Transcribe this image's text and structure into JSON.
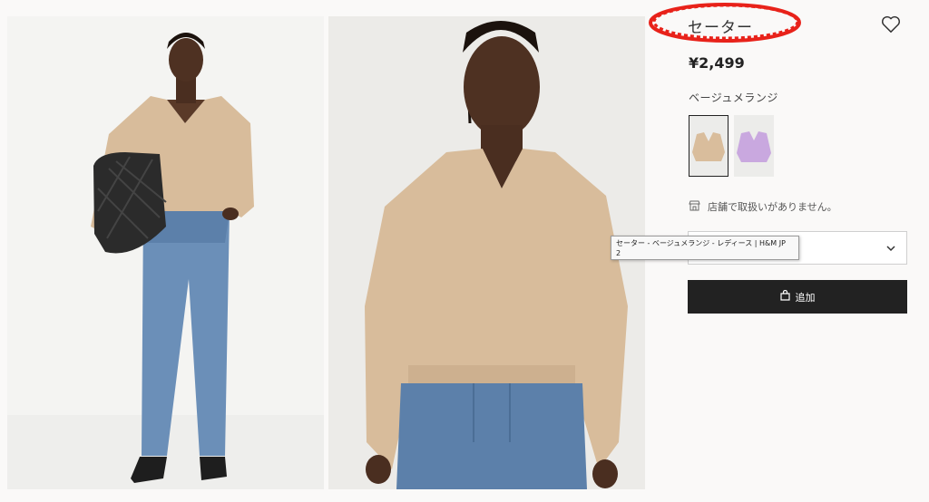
{
  "product": {
    "title": "セーター",
    "price": "¥2,499",
    "color_name": "ベージュメランジ",
    "swatches": [
      {
        "color": "beige",
        "hex": "#d9bd9c",
        "selected": true
      },
      {
        "color": "lilac",
        "hex": "#c9a8df",
        "selected": false
      }
    ],
    "store_availability": "店舗で取扱いがありません。"
  },
  "size_select": {
    "value": ""
  },
  "tooltip": {
    "text": "セーター - ベージュメランジ - レディース | H&M JP\n2"
  },
  "add_button": {
    "label": "追加"
  },
  "colors": {
    "accent_dark": "#222222",
    "annotation_red": "#e8221a"
  }
}
